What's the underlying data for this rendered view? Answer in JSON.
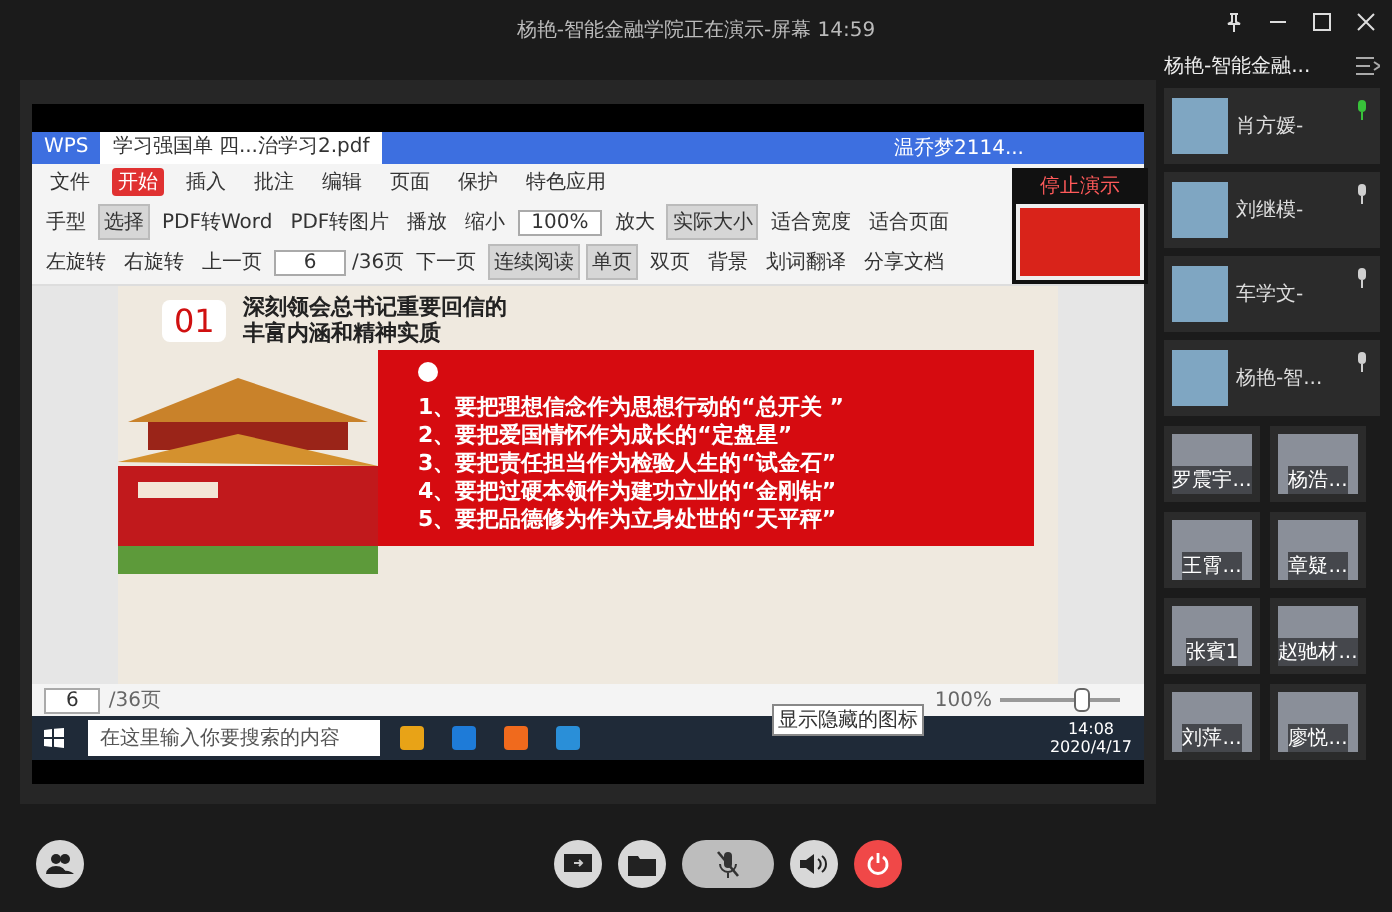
{
  "window": {
    "title": "杨艳-智能金融学院正在演示-屏幕 14:59"
  },
  "sidebar": {
    "title": "杨艳-智能金融...",
    "featured": [
      {
        "name": "肖方媛-",
        "speaking": true
      },
      {
        "name": "刘继模-",
        "speaking": false
      },
      {
        "name": "车学文-",
        "speaking": false
      },
      {
        "name": "杨艳-智...",
        "speaking": false
      }
    ],
    "grid": [
      {
        "name": "罗震宇..."
      },
      {
        "name": "杨浩..."
      },
      {
        "name": "王霄..."
      },
      {
        "name": "章疑..."
      },
      {
        "name": "张賓1"
      },
      {
        "name": "赵驰材..."
      },
      {
        "name": "刘萍..."
      },
      {
        "name": "廖悦..."
      }
    ]
  },
  "shared_screen": {
    "tabs": [
      {
        "label": "WPS",
        "selected": false
      },
      {
        "label": "学习强国单 四...治学习2.pdf",
        "selected": true
      }
    ],
    "account": "温乔梦2114...",
    "menu": [
      {
        "label": "文件",
        "selected": false
      },
      {
        "label": "开始",
        "selected": true
      },
      {
        "label": "插入",
        "selected": false
      },
      {
        "label": "批注",
        "selected": false
      },
      {
        "label": "编辑",
        "selected": false
      },
      {
        "label": "页面",
        "selected": false
      },
      {
        "label": "保护",
        "selected": false
      },
      {
        "label": "特色应用",
        "selected": false
      }
    ],
    "toolbar": [
      {
        "kind": "button",
        "label": "手型",
        "selected": false
      },
      {
        "kind": "button",
        "label": "选择",
        "selected": true
      },
      {
        "kind": "button",
        "label": "PDF转Word",
        "selected": false
      },
      {
        "kind": "button",
        "label": "PDF转图片",
        "selected": false
      },
      {
        "kind": "button",
        "label": "播放",
        "selected": false
      },
      {
        "kind": "button",
        "label": "缩小",
        "selected": false
      },
      {
        "kind": "field",
        "label": "100%"
      },
      {
        "kind": "button",
        "label": "放大",
        "selected": false
      },
      {
        "kind": "button",
        "label": "实际大小",
        "selected": true
      },
      {
        "kind": "button",
        "label": "适合宽度",
        "selected": false
      },
      {
        "kind": "button",
        "label": "适合页面",
        "selected": false
      },
      {
        "kind": "button",
        "label": "左旋转",
        "selected": false
      },
      {
        "kind": "button",
        "label": "右旋转",
        "selected": false
      },
      {
        "kind": "button",
        "label": "上一页",
        "selected": false
      },
      {
        "kind": "field",
        "label": "6"
      },
      {
        "kind": "text",
        "label": "/36页"
      },
      {
        "kind": "button",
        "label": "下一页",
        "selected": false
      },
      {
        "kind": "button",
        "label": "连续阅读",
        "selected": true
      },
      {
        "kind": "button",
        "label": "单页",
        "selected": true
      },
      {
        "kind": "button",
        "label": "双页",
        "selected": false
      },
      {
        "kind": "button",
        "label": "背景",
        "selected": false
      },
      {
        "kind": "button",
        "label": "划词翻译",
        "selected": false
      },
      {
        "kind": "button",
        "label": "分享文档",
        "selected": false
      }
    ],
    "preview_button": "停止演示",
    "slide": {
      "number": "01",
      "title": [
        "深刻领会总书记重要回信的",
        "丰富内涵和精神实质"
      ],
      "points": [
        "1、要把理想信念作为思想行动的“总开关 ”",
        "2、要把爱国情怀作为成长的“定盘星”",
        "3、要把责任担当作为检验人生的“试金石”",
        "4、要把过硬本领作为建功立业的“金刚钻”",
        "5、要把品德修为作为立身处世的“天平秤”"
      ]
    },
    "status": {
      "page": "6",
      "total": "/36页",
      "zoom": "100%",
      "level": 0.72
    },
    "taskbar": {
      "search_placeholder": "在这里输入你要搜索的内容",
      "tooltip": "显示隐藏的图标",
      "time": "14:08",
      "date": "2020/4/17"
    }
  },
  "controls": {
    "muted": true
  }
}
